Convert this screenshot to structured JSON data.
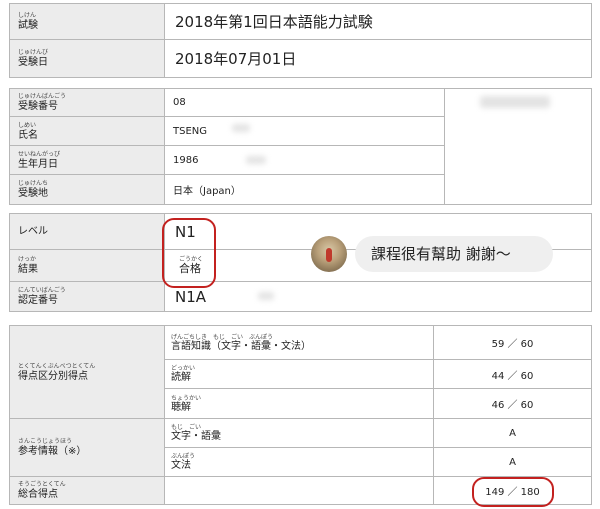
{
  "exam": {
    "label_ruby": "しけん",
    "label": "試験",
    "value": "2018年第1回日本語能力試験",
    "date_label_ruby": "じゅけんび",
    "date_label": "受験日",
    "date_value": "2018年07月01日"
  },
  "personal": {
    "number_ruby": "じゅけんばんごう",
    "number_label": "受験番号",
    "number_value": "08",
    "name_ruby": "しめい",
    "name_label": "氏名",
    "name_value": "TSENG",
    "birth_ruby": "せいねんがっぴ",
    "birth_label": "生年月日",
    "birth_value": "1986",
    "place_ruby": "じゅけんち",
    "place_label": "受験地",
    "place_value": "日本（Japan）"
  },
  "result": {
    "level_label": "レベル",
    "level_value": "N1",
    "result_ruby": "けっか",
    "result_label": "結果",
    "result_value_ruby": "ごうかく",
    "result_value": "合格",
    "cert_ruby": "にんていばんごう",
    "cert_label": "認定番号",
    "cert_value": "N1A"
  },
  "scores": {
    "section_ruby": "とくてんくぶんべつとくてん",
    "section_label": "得点区分別得点",
    "items": [
      {
        "ruby": "げんごちしき　もじ　ごい　ぶんぽう",
        "label": "言語知識（文字・語彙・文法）",
        "value": "59 ／ 60"
      },
      {
        "ruby": "どっかい",
        "label": "読解",
        "value": "44 ／ 60"
      },
      {
        "ruby": "ちょうかい",
        "label": "聴解",
        "value": "46 ／ 60"
      }
    ],
    "ref_ruby": "さんこうじょうほう",
    "ref_label": "参考情報（※）",
    "ref_items": [
      {
        "ruby": "もじ　ごい",
        "label": "文字・語彙",
        "value": "A"
      },
      {
        "ruby": "ぶんぽう",
        "label": "文法",
        "value": "A"
      }
    ],
    "total_ruby": "そうごうとくてん",
    "total_label": "総合得点",
    "total_value": "149 ／ 180"
  },
  "comment": {
    "text": "課程很有幫助 謝謝～"
  }
}
